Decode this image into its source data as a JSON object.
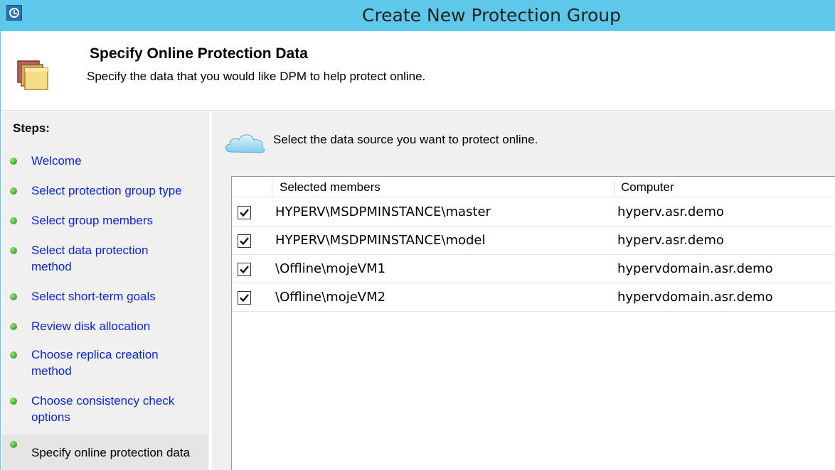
{
  "window": {
    "title": "Create New Protection Group"
  },
  "header": {
    "title": "Specify Online Protection Data",
    "subtitle": "Specify the data that you would like DPM to help protect online."
  },
  "steps": {
    "heading": "Steps:",
    "items": [
      {
        "lines": [
          "Welcome"
        ],
        "status": "done"
      },
      {
        "lines": [
          "Select protection group type"
        ],
        "status": "done"
      },
      {
        "lines": [
          "Select group members"
        ],
        "status": "done"
      },
      {
        "lines": [
          "Select data protection",
          "method"
        ],
        "status": "done"
      },
      {
        "lines": [
          "Select short-term goals"
        ],
        "status": "done"
      },
      {
        "lines": [
          "Review disk allocation"
        ],
        "status": "done"
      },
      {
        "lines": [
          "Choose replica creation",
          "method"
        ],
        "status": "done"
      },
      {
        "lines": [
          "Choose consistency check",
          "options"
        ],
        "status": "done"
      },
      {
        "lines": [
          "Specify online protection data"
        ],
        "status": "current"
      }
    ]
  },
  "content": {
    "instruction": "Select the data source you want to protect online.",
    "table": {
      "columns": [
        "Selected members",
        "Computer"
      ],
      "rows": [
        {
          "checked": true,
          "member": "HYPERV\\MSDPMINSTANCE\\master",
          "computer": "hyperv.asr.demo"
        },
        {
          "checked": true,
          "member": "HYPERV\\MSDPMINSTANCE\\model",
          "computer": "hyperv.asr.demo"
        },
        {
          "checked": true,
          "member": "\\Offline\\mojeVM1",
          "computer": "hypervdomain.asr.demo"
        },
        {
          "checked": true,
          "member": "\\Offline\\mojeVM2",
          "computer": "hypervdomain.asr.demo"
        }
      ]
    }
  },
  "icons": {
    "app": "dpm-clock-icon",
    "header": "folder-icon",
    "instruction": "cloud-icon",
    "step_status": "green-dot-icon",
    "row_checkbox": "checkmark-icon"
  },
  "colors": {
    "titlebar": "#5ec8ea",
    "step_link": "#0b24d8",
    "panel_bg": "#f0f0f0"
  }
}
